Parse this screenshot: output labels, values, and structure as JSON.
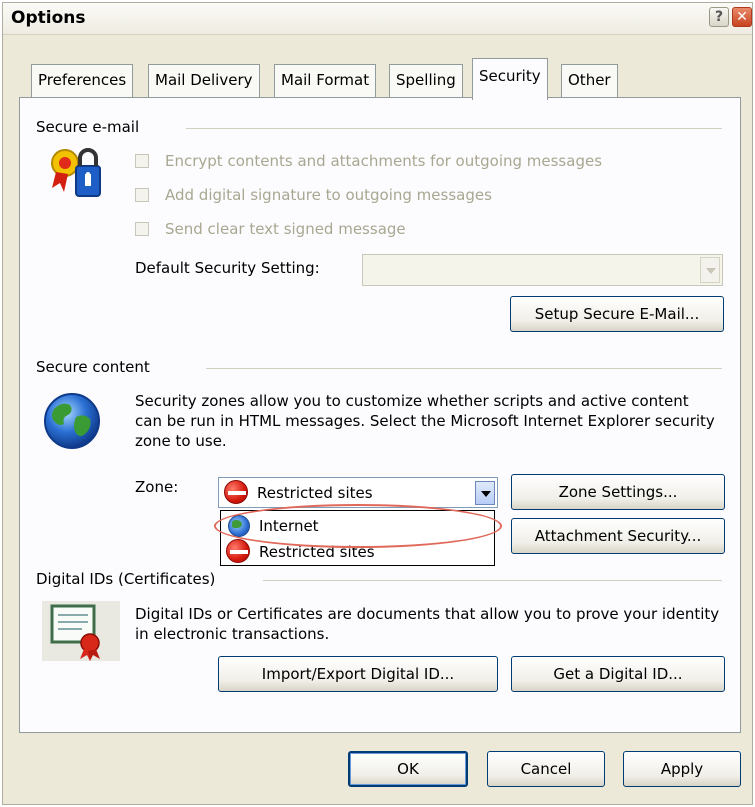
{
  "window": {
    "title": "Options"
  },
  "tabs": [
    {
      "label": "Preferences"
    },
    {
      "label": "Mail Delivery"
    },
    {
      "label": "Mail Format"
    },
    {
      "label": "Spelling"
    },
    {
      "label": "Security"
    },
    {
      "label": "Other"
    }
  ],
  "secure_email": {
    "title": "Secure e-mail",
    "checkboxes": [
      {
        "label": "Encrypt contents and attachments for outgoing messages",
        "checked": false,
        "enabled": false
      },
      {
        "label": "Add digital signature to outgoing messages",
        "checked": false,
        "enabled": false
      },
      {
        "label": "Send clear text signed message",
        "checked": false,
        "enabled": false
      }
    ],
    "default_setting_label": "Default Security Setting:",
    "default_setting_value": "",
    "setup_button": "Setup Secure E-Mail..."
  },
  "secure_content": {
    "title": "Secure content",
    "description": "Security zones allow you to customize whether scripts and active content can be run in HTML messages.  Select the Microsoft Internet Explorer security zone to use.",
    "zone_label": "Zone:",
    "zone_value": "Restricted sites",
    "zone_options": [
      {
        "label": "Internet",
        "icon": "internet-zone-icon"
      },
      {
        "label": "Restricted sites",
        "icon": "restricted-sites-icon"
      }
    ],
    "zone_settings_button": "Zone Settings...",
    "attachment_security_button": "Attachment Security..."
  },
  "digital_ids": {
    "title": "Digital IDs (Certificates)",
    "description": "Digital IDs or Certificates are documents that allow you to prove your identity in electronic transactions.",
    "import_button": "Import/Export Digital ID...",
    "get_button": "Get a Digital ID..."
  },
  "footer": {
    "ok": "OK",
    "cancel": "Cancel",
    "apply": "Apply"
  },
  "colors": {
    "dialog_bg": "#ece9d8",
    "panel_bg": "#fcfcfe",
    "highlight_oval": "#e0695a",
    "close_button": "#c8431f"
  }
}
